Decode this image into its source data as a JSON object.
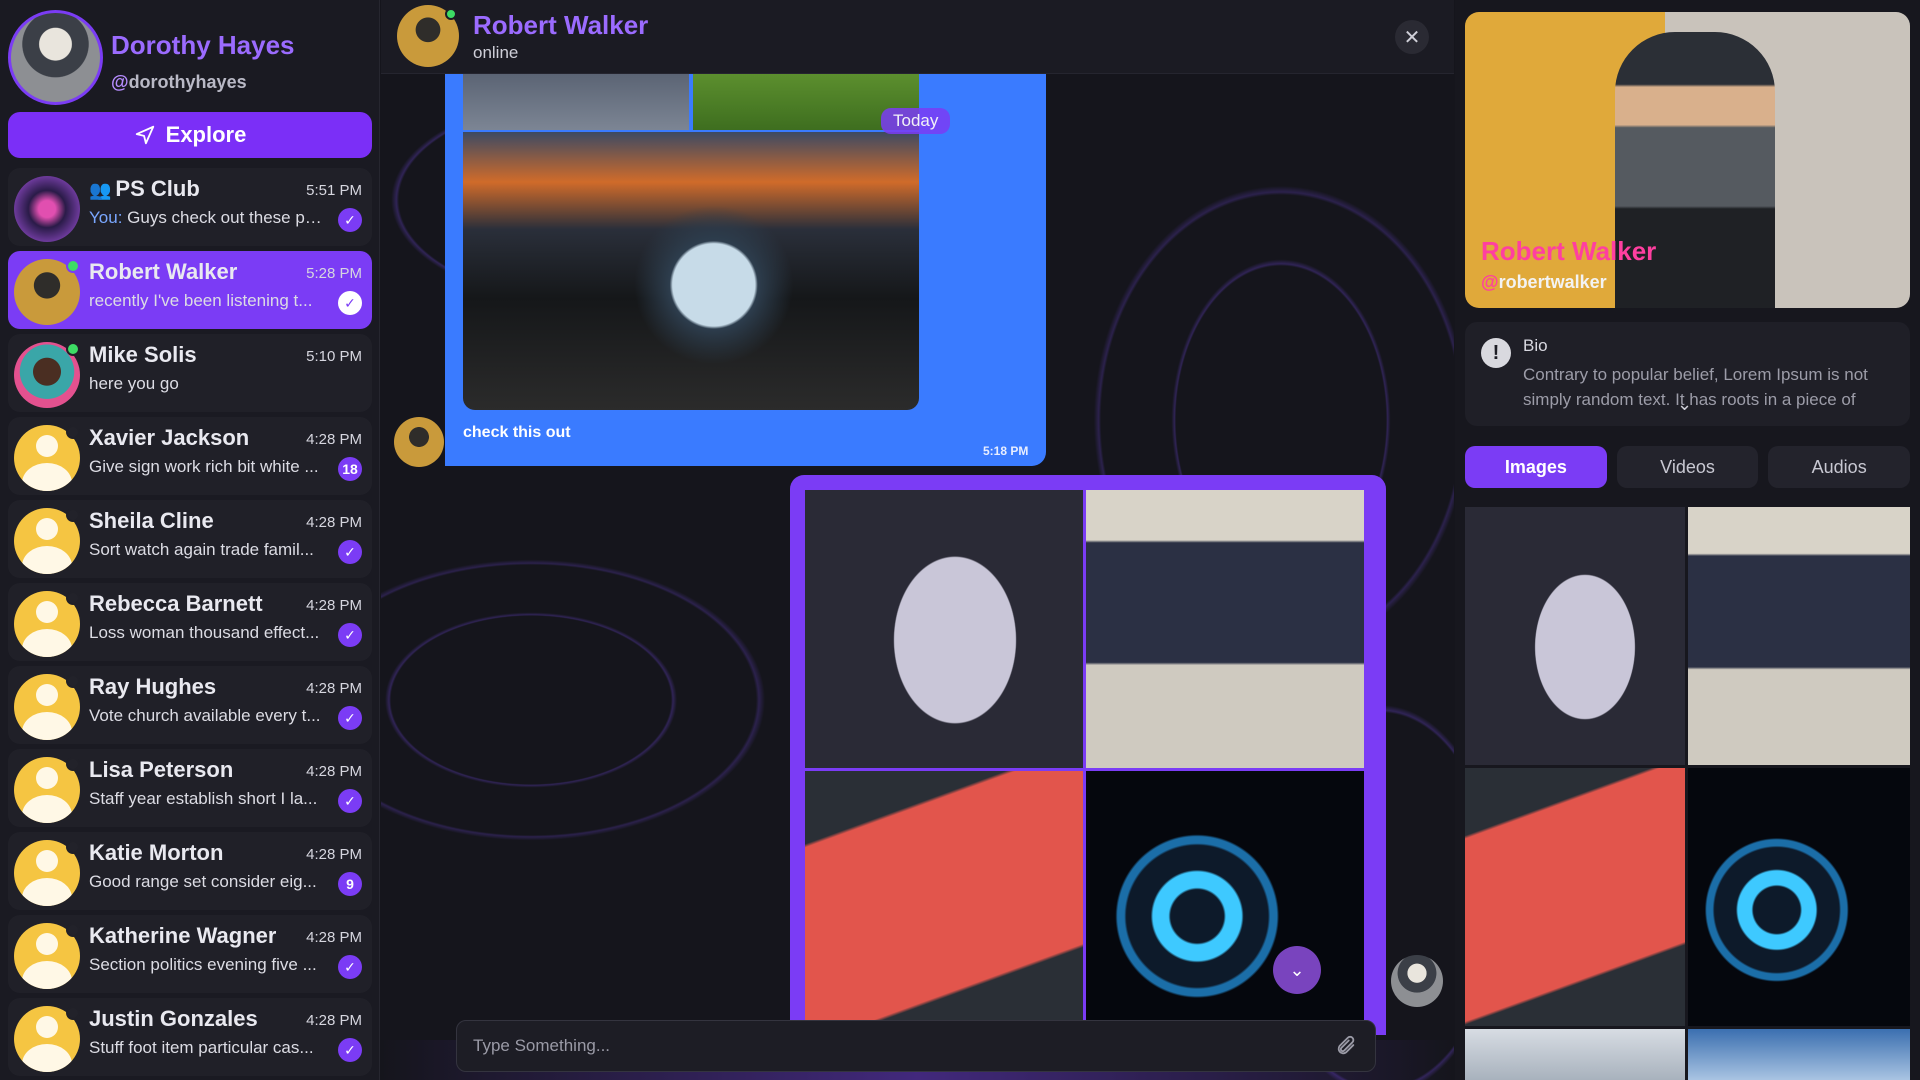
{
  "me": {
    "name": "Dorothy Hayes",
    "handle_at": "@",
    "handle": "dorothyhayes"
  },
  "explore": {
    "label": "Explore"
  },
  "conversations": [
    {
      "name": "PS Club",
      "time": "5:51 PM",
      "you_prefix": "You:",
      "preview": "Guys check out these pc...",
      "status": "read",
      "group": true
    },
    {
      "name": "Robert Walker",
      "time": "5:28 PM",
      "preview": "recently I've been listening t...",
      "status": "read",
      "online": true,
      "active": true
    },
    {
      "name": "Mike Solis",
      "time": "5:10 PM",
      "preview": "here you go",
      "status": "",
      "online": true
    },
    {
      "name": "Xavier Jackson",
      "time": "4:28 PM",
      "preview": "Give sign work rich bit white ...",
      "status": "18"
    },
    {
      "name": "Sheila Cline",
      "time": "4:28 PM",
      "preview": "Sort watch again trade famil...",
      "status": "read"
    },
    {
      "name": "Rebecca Barnett",
      "time": "4:28 PM",
      "preview": "Loss woman thousand effect...",
      "status": "read"
    },
    {
      "name": "Ray Hughes",
      "time": "4:28 PM",
      "preview": "Vote church available every t...",
      "status": "read"
    },
    {
      "name": "Lisa Peterson",
      "time": "4:28 PM",
      "preview": "Staff year establish short I la...",
      "status": "read"
    },
    {
      "name": "Katie Morton",
      "time": "4:28 PM",
      "preview": "Good range set consider eig...",
      "status": "9"
    },
    {
      "name": "Katherine Wagner",
      "time": "4:28 PM",
      "preview": "Section politics evening five ...",
      "status": "read"
    },
    {
      "name": "Justin Gonzales",
      "time": "4:28 PM",
      "preview": "Stuff foot item particular cas...",
      "status": "read"
    }
  ],
  "chat": {
    "contact_name": "Robert Walker",
    "contact_status": "online",
    "date_badge": "Today",
    "messages": [
      {
        "caption": "check this out",
        "time": "5:18 PM"
      }
    ],
    "composer_placeholder": "Type Something..."
  },
  "profile": {
    "name": "Robert Walker",
    "handle_at": "@",
    "handle": "robertwalker",
    "bio_title": "Bio",
    "bio_text": "Contrary to popular belief, Lorem Ipsum is not simply random text. It has roots in a piece of",
    "tabs": [
      "Images",
      "Videos",
      "Audios"
    ],
    "active_tab": "Images"
  },
  "colors": {
    "accent": "#7b3cf5",
    "explore": "#7b2ff7",
    "bubble_in": "#3a7bff",
    "online": "#3ddc64",
    "profile_name": "#ff3fa0"
  },
  "icons": [
    "send-icon",
    "group-icon",
    "check-icon",
    "close-icon",
    "chevron-down-icon",
    "paperclip-icon",
    "info-icon"
  ]
}
